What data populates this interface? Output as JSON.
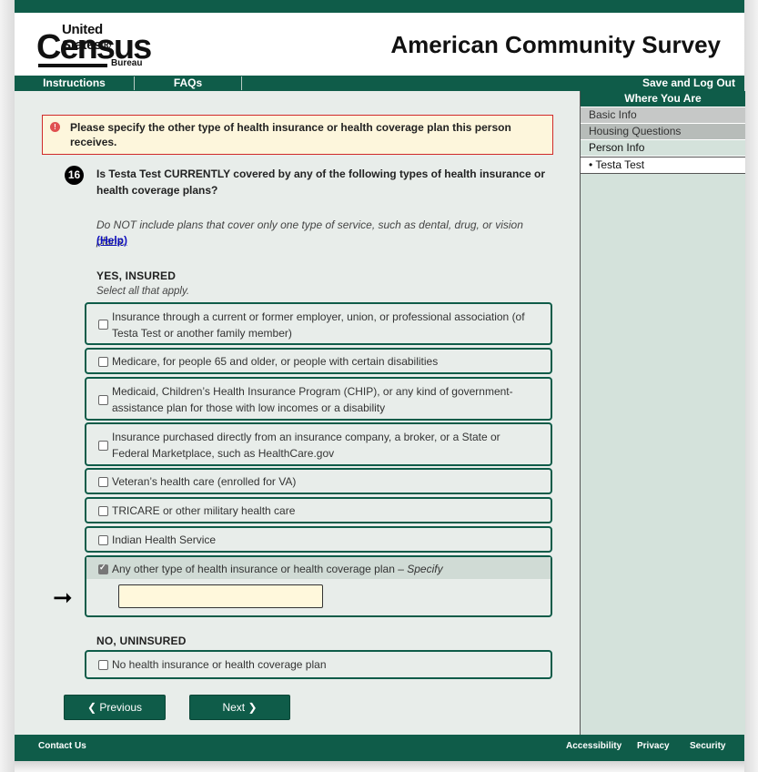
{
  "header": {
    "logo_united_states": "United States®",
    "logo_census": "Census",
    "logo_bureau": "Bureau",
    "survey_title": "American Community Survey"
  },
  "nav": {
    "instructions": "Instructions",
    "faqs": "FAQs",
    "save_logout": "Save and Log Out"
  },
  "sidebar": {
    "title": "Where You Are",
    "items": [
      "Basic Info",
      "Housing Questions",
      "Person Info"
    ],
    "sub_item": "• Testa Test"
  },
  "error": {
    "icon": "exclamation-icon",
    "text": "Please specify the other type of health insurance or health coverage plan this person receives."
  },
  "question": {
    "number": "16",
    "text": "Is Testa Test CURRENTLY covered by any of the following types of health insurance or health coverage plans?",
    "note": "Do NOT include plans that cover only one type of service, such as dental, drug, or vision plans.",
    "help_label": "(Help)"
  },
  "yes_section": {
    "heading": "YES, INSURED",
    "subheading": "Select all that apply.",
    "options": [
      {
        "label": "Insurance through a current or former employer, union, or professional association (of Testa Test or another family member)",
        "checked": false
      },
      {
        "label": "Medicare, for people 65 and older, or people with certain disabilities",
        "checked": false
      },
      {
        "label": "Medicaid, Children’s Health Insurance Program (CHIP), or any kind of government-assistance plan for those with low incomes or a disability",
        "checked": false
      },
      {
        "label": "Insurance purchased directly from an insurance company, a broker, or a State or Federal Marketplace, such as HealthCare.gov",
        "checked": false
      },
      {
        "label": "Veteran’s health care (enrolled for VA)",
        "checked": false
      },
      {
        "label": "TRICARE or other military health care",
        "checked": false
      },
      {
        "label": "Indian Health Service",
        "checked": false
      },
      {
        "label": "Any other type of health insurance or health coverage plan –",
        "label_italic": "Specify",
        "checked": true
      }
    ],
    "specify_value": ""
  },
  "no_section": {
    "heading": "NO, UNINSURED",
    "option": {
      "label": "No health insurance or health coverage plan",
      "checked": false
    }
  },
  "buttons": {
    "previous": "Previous",
    "next": "Next"
  },
  "footer": {
    "contact": "Contact Us",
    "accessibility": "Accessibility",
    "privacy": "Privacy",
    "security": "Security"
  },
  "colors": {
    "brand_green": "#0f5c49",
    "error_border": "#d02a2a",
    "error_bg": "#fdf6dc",
    "input_bg": "#fff8dc"
  }
}
